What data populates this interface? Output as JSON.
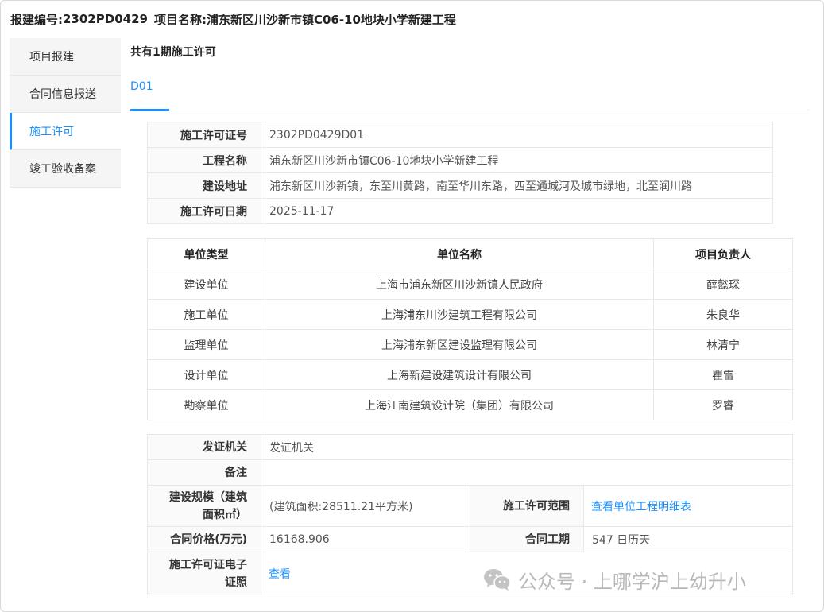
{
  "header": {
    "code_label": "报建编号:",
    "code_value": "2302PD0429",
    "name_label": "项目名称:",
    "name_value": "浦东新区川沙新市镇C06-10地块小学新建工程"
  },
  "sidebar": {
    "items": [
      {
        "label": "项目报建",
        "active": false
      },
      {
        "label": "合同信息报送",
        "active": false
      },
      {
        "label": "施工许可",
        "active": true
      },
      {
        "label": "竣工验收备案",
        "active": false
      }
    ]
  },
  "content": {
    "count_title": "共有1期施工许可",
    "tabs": [
      {
        "label": "D01",
        "active": true
      }
    ]
  },
  "permit_info": [
    {
      "label": "施工许可证号",
      "value": "2302PD0429D01"
    },
    {
      "label": "工程名称",
      "value": "浦东新区川沙新市镇C06-10地块小学新建工程"
    },
    {
      "label": "建设地址",
      "value": "浦东新区川沙新镇，东至川黄路，南至华川东路，西至通城河及城市绿地，北至润川路"
    },
    {
      "label": "施工许可日期",
      "value": "2025-11-17"
    }
  ],
  "units": {
    "headers": [
      "单位类型",
      "单位名称",
      "项目负责人"
    ],
    "rows": [
      {
        "type": "建设单位",
        "name": "上海市浦东新区川沙新镇人民政府",
        "leader": "薛懿琛"
      },
      {
        "type": "施工单位",
        "name": "上海浦东川沙建筑工程有限公司",
        "leader": "朱良华"
      },
      {
        "type": "监理单位",
        "name": "上海浦东新区建设监理有限公司",
        "leader": "林清宁"
      },
      {
        "type": "设计单位",
        "name": "上海新建设建筑设计有限公司",
        "leader": "瞿雷"
      },
      {
        "type": "勘察单位",
        "name": "上海江南建筑设计院（集团）有限公司",
        "leader": "罗睿"
      }
    ]
  },
  "details": {
    "issuer_label": "发证机关",
    "issuer_value": "发证机关",
    "remark_label": "备注",
    "remark_value": "",
    "scale_label_line1": "建设规模（建筑",
    "scale_label_line2": "面积㎡）",
    "scale_value": "(建筑面积:28511.21平方米)",
    "scope_label": "施工许可范围",
    "scope_link": "查看单位工程明细表",
    "price_label": "合同价格(万元)",
    "price_value": "16168.906",
    "period_label": "合同工期",
    "period_value": "547 日历天",
    "ecert_label_line1": "施工许可证电子",
    "ecert_label_line2": "证照",
    "ecert_link": "查看"
  },
  "watermark": {
    "text": "公众号 · 上哪学沪上幼升小",
    "icon": "wechat-icon"
  }
}
